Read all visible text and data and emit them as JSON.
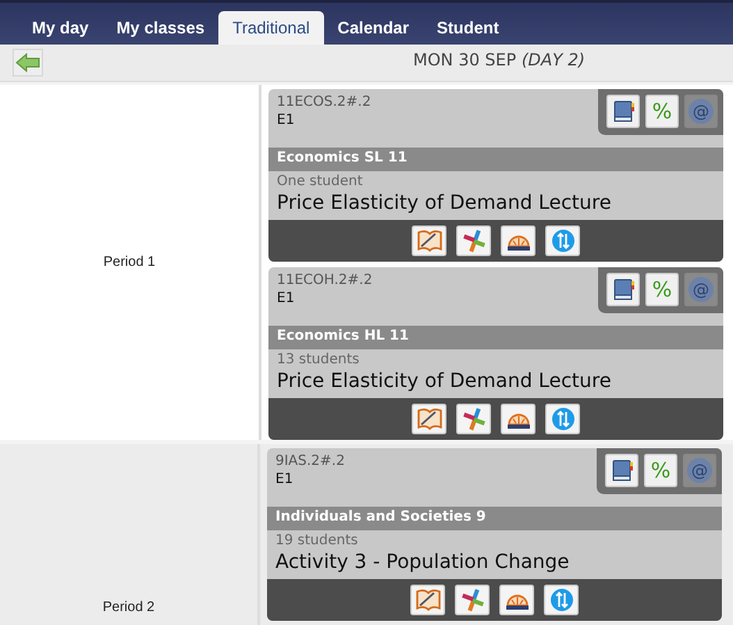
{
  "tabs": [
    {
      "label": "My day",
      "selected": false
    },
    {
      "label": "My classes",
      "selected": false
    },
    {
      "label": "Traditional",
      "selected": true
    },
    {
      "label": "Calendar",
      "selected": false
    },
    {
      "label": "Student",
      "selected": false
    }
  ],
  "header": {
    "date": "MON 30 SEP",
    "day": "(DAY 2)"
  },
  "card_tools": {
    "percent": "%",
    "at": "@"
  },
  "periods": [
    {
      "label": "Period 1",
      "classes": [
        {
          "code": "11ECOS.2#.2",
          "room": "E1",
          "subject": "Economics SL 11",
          "students": "One student",
          "lesson": "Price Elasticity of Demand Lecture"
        },
        {
          "code": "11ECOH.2#.2",
          "room": "E1",
          "subject": "Economics HL 11",
          "students": "13 students",
          "lesson": "Price Elasticity of Demand Lecture"
        }
      ]
    },
    {
      "label": "Period 2",
      "classes": [
        {
          "code": "9IAS.2#.2",
          "room": "E1",
          "subject": "Individuals and Societies 9",
          "students": "19 students",
          "lesson": "Activity 3 - Population Change"
        }
      ]
    }
  ]
}
